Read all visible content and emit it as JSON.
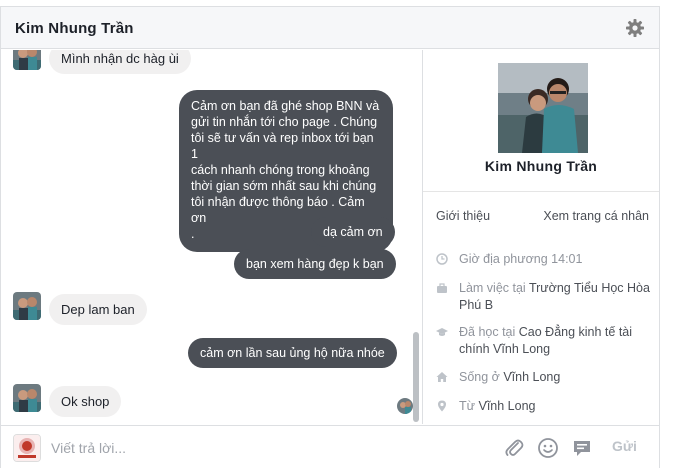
{
  "header": {
    "title": "Kim Nhung Trần",
    "settings_icon": "gear-icon"
  },
  "messages": [
    {
      "dir": "in",
      "text": "Mình nhận dc hàg ùi",
      "partial": true
    },
    {
      "dir": "out",
      "text": "Cảm ơn bạn đã ghé shop BNN và\ngửi tin nhắn tới cho page . Chúng\ntôi sẽ tư vấn và rep inbox tới bạn 1\ncách nhanh chóng trong khoảng\nthời gian sớm nhất sau khi chúng\ntôi nhận được thông báo . Cảm ơn\n."
    },
    {
      "dir": "out",
      "text": "dạ cảm ơn"
    },
    {
      "dir": "out",
      "text": "bạn xem hàng đẹp k bạn"
    },
    {
      "dir": "in",
      "text": "Dep lam ban"
    },
    {
      "dir": "out",
      "text": "cảm ơn lần sau ủng hộ nữa nhóe"
    },
    {
      "dir": "in",
      "text": "Ok shop"
    }
  ],
  "profile": {
    "name": "Kim Nhung Trần",
    "intro_title": "Giới thiệu",
    "view_profile": "Xem trang cá nhân",
    "local_time": "Giờ địa phương 14:01",
    "work_prefix": "Làm việc tại ",
    "work_place": "Trường Tiểu Học Hòa Phú B",
    "study_prefix": "Đã học tại ",
    "study_place": "Cao Đẳng kinh tế tài chính Vĩnh Long",
    "lives_prefix": "Sống ở ",
    "lives_place": "Vĩnh Long",
    "from_prefix": "Từ ",
    "from_place": "Vĩnh Long"
  },
  "composer": {
    "placeholder": "Viết trả lời...",
    "send_label": "Gửi",
    "icons": [
      "paperclip-icon",
      "emoji-icon",
      "sticker-icon"
    ]
  },
  "colors": {
    "outgoing_bubble": "#4b4f56",
    "incoming_bubble": "#f1f0f0",
    "send_disabled": "#bec3c9"
  }
}
